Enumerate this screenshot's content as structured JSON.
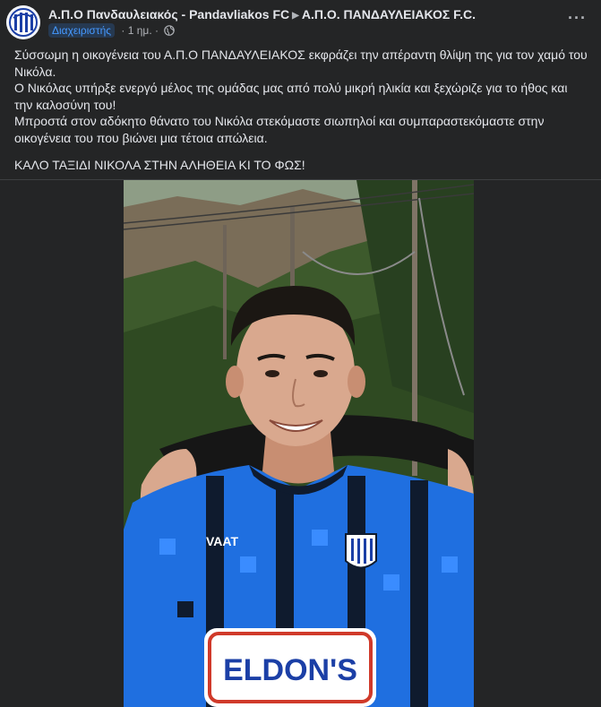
{
  "header": {
    "page_name": "Α.Π.Ο Πανδαυλειακός - Pandavliakos FC",
    "group_name": "Α.Π.Ο. ΠΑΝΔΑΥΛΕΙΑΚΟΣ F.C.",
    "role_badge": "Διαχειριστής",
    "time": "1 ημ.",
    "separator": "·",
    "more_label": "···",
    "privacy_icon": "globe-icon",
    "arrow_icon": "triangle-right-icon"
  },
  "post": {
    "lines": [
      "Σύσσωμη η οικογένεια του Α.Π.Ο ΠΑΝΔΑΥΛΕΙΑΚΟΣ εκφράζει την απέραντη θλίψη της για τον χαμό του Νικόλα.",
      "Ο Νικόλας υπήρξε ενεργό μέλος της ομάδας μας από πολύ μικρή ηλικία και ξεχώριζε για το ήθος και την καλοσύνη του!",
      "Μπροστά στον αδόκητο θάνατο του Νικόλα στεκόμαστε σιωπηλοί και συμπαραστεκόμαστε στην οικογένεια του που βιώνει μια τέτοια απώλεια."
    ],
    "closing": "ΚΑΛΟ ΤΑΞΙΔΙ ΝΙΚΟΛΑ ΣΤΗΝ ΑΛΗΘΕΙΑ ΚΙ ΤΟ ΦΩΣ!"
  },
  "photo": {
    "jersey_sponsor": "ELDON'S",
    "jersey_brand": "VAAT"
  },
  "colors": {
    "background": "#242526",
    "text_primary": "#e4e6eb",
    "text_secondary": "#b0b3b8",
    "badge_bg": "#263951",
    "badge_text": "#4599ff",
    "jersey_blue": "#1f6fe0"
  }
}
